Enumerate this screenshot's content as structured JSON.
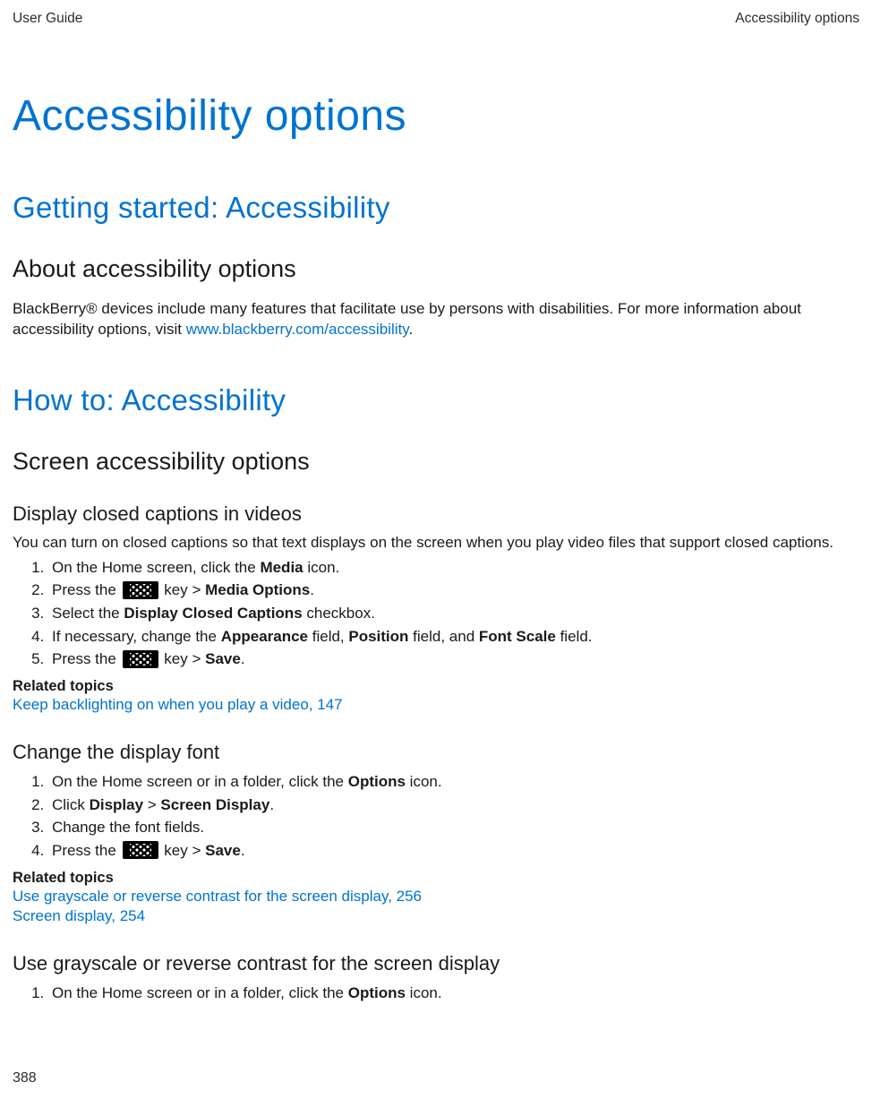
{
  "header": {
    "left": "User Guide",
    "right": "Accessibility options"
  },
  "title": "Accessibility options",
  "section1": {
    "heading": "Getting started: Accessibility",
    "sub": {
      "heading": "About accessibility options",
      "para_pre": "BlackBerry® devices include many features that facilitate use by persons with disabilities. For more information about accessibility options, visit ",
      "link": "www.blackberry.com/accessibility",
      "para_post": "."
    }
  },
  "section2": {
    "heading": "How to: Accessibility",
    "sub": {
      "heading": "Screen accessibility options",
      "topic1": {
        "heading": "Display closed captions in videos",
        "intro": "You can turn on closed captions so that text displays on the screen when you play video files that support closed captions.",
        "steps": {
          "s1_pre": "On the Home screen, click the ",
          "s1_b": "Media",
          "s1_post": " icon.",
          "s2_pre": "Press the ",
          "s2_mid": " key > ",
          "s2_b": "Media Options",
          "s2_post": ".",
          "s3_pre": "Select the ",
          "s3_b": "Display Closed Captions",
          "s3_post": " checkbox.",
          "s4_pre": "If necessary, change the ",
          "s4_b1": "Appearance",
          "s4_m1": " field, ",
          "s4_b2": "Position",
          "s4_m2": " field, and ",
          "s4_b3": "Font Scale",
          "s4_post": " field.",
          "s5_pre": "Press the ",
          "s5_mid": " key > ",
          "s5_b": "Save",
          "s5_post": "."
        },
        "related_heading": "Related topics",
        "related_link1": "Keep backlighting on when you play a video, 147"
      },
      "topic2": {
        "heading": "Change the display font",
        "steps": {
          "s1_pre": "On the Home screen or in a folder, click the ",
          "s1_b": "Options",
          "s1_post": " icon.",
          "s2_pre": "Click ",
          "s2_b1": "Display",
          "s2_mid": " > ",
          "s2_b2": "Screen Display",
          "s2_post": ".",
          "s3": "Change the font fields.",
          "s4_pre": "Press the ",
          "s4_mid": " key > ",
          "s4_b": "Save",
          "s4_post": "."
        },
        "related_heading": "Related topics",
        "related_link1": "Use grayscale or reverse contrast for the screen display, 256",
        "related_link2": "Screen display, 254"
      },
      "topic3": {
        "heading": "Use grayscale or reverse contrast for the screen display",
        "steps": {
          "s1_pre": "On the Home screen or in a folder, click the ",
          "s1_b": "Options",
          "s1_post": " icon."
        }
      }
    }
  },
  "page_number": "388"
}
